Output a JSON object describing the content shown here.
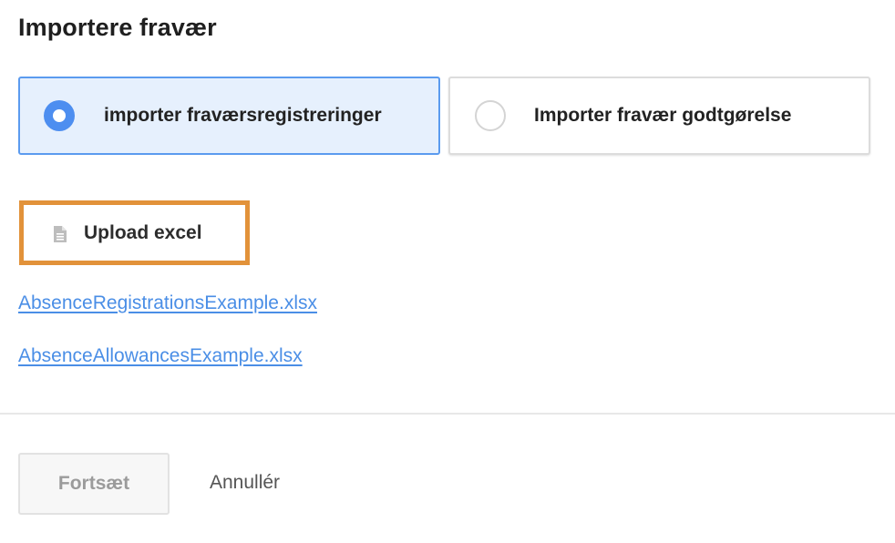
{
  "dialog": {
    "title": "Importere fravær"
  },
  "import_options": [
    {
      "label": "importer fraværsregistreringer",
      "selected": true
    },
    {
      "label": "Importer fravær godtgørelse",
      "selected": false
    }
  ],
  "upload": {
    "label": "Upload excel",
    "icon": "file-icon"
  },
  "examples": [
    {
      "label": "AbsenceRegistrationsExample.xlsx"
    },
    {
      "label": "AbsenceAllowancesExample.xlsx"
    }
  ],
  "footer": {
    "continue_label": "Fortsæt",
    "continue_disabled": true,
    "cancel_label": "Annullér"
  },
  "colors": {
    "accent": "#4d8ef0",
    "selected_bg": "#e6f0fd",
    "highlight_border": "#e2923a",
    "link": "#4a8ee6"
  }
}
